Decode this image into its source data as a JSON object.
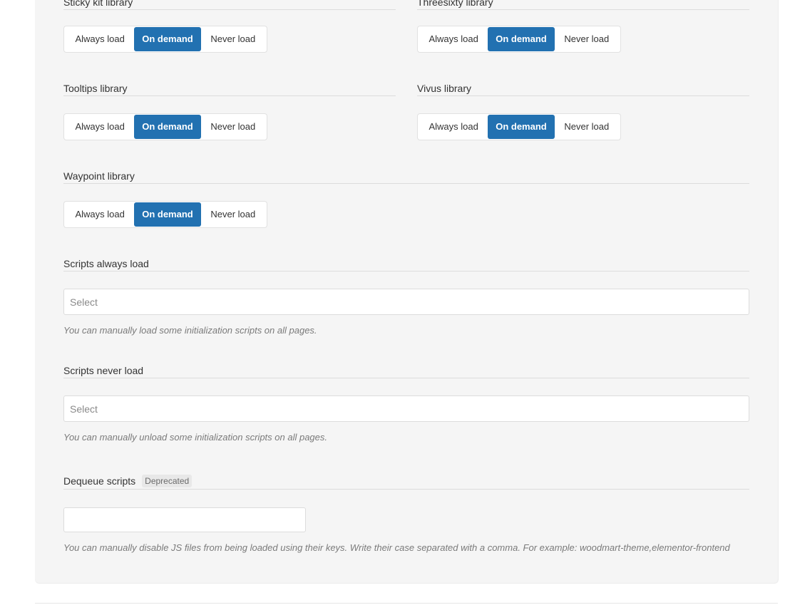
{
  "libraries": [
    {
      "title": "Sticky kit library",
      "selected": "On demand"
    },
    {
      "title": "Threesixty library",
      "selected": "On demand"
    },
    {
      "title": "Tooltips library",
      "selected": "On demand"
    },
    {
      "title": "Vivus library",
      "selected": "On demand"
    },
    {
      "title": "Waypoint library",
      "selected": "On demand"
    }
  ],
  "options": {
    "always": "Always load",
    "demand": "On demand",
    "never": "Never load"
  },
  "scripts_always": {
    "title": "Scripts always load",
    "placeholder": "Select",
    "hint": "You can manually load some initialization scripts on all pages."
  },
  "scripts_never": {
    "title": "Scripts never load",
    "placeholder": "Select",
    "hint": "You can manually unload some initialization scripts on all pages."
  },
  "dequeue": {
    "title": "Dequeue scripts",
    "badge": "Deprecated",
    "value": "",
    "hint": "You can manually disable JS files from being loaded using their keys. Write their case separated with a comma. For example: woodmart-theme,elementor-frontend"
  },
  "colors": {
    "accent": "#2271b1",
    "panel": "#f5f5f5"
  }
}
